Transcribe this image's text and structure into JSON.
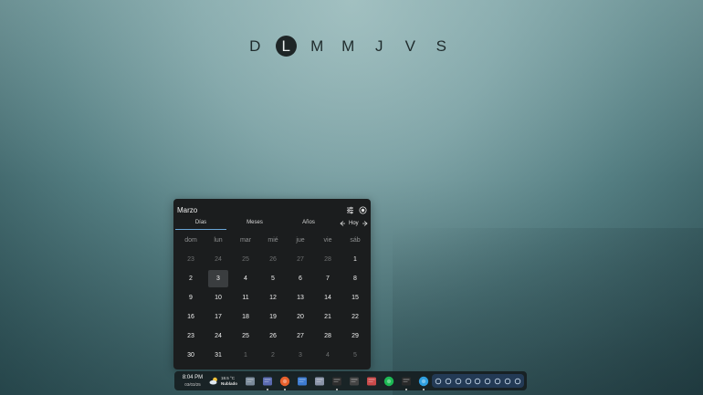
{
  "weekdays": [
    {
      "label": "D",
      "active": false
    },
    {
      "label": "L",
      "active": true
    },
    {
      "label": "M",
      "active": false
    },
    {
      "label": "M",
      "active": false
    },
    {
      "label": "J",
      "active": false
    },
    {
      "label": "V",
      "active": false
    },
    {
      "label": "S",
      "active": false
    }
  ],
  "calendar": {
    "title": "Marzo",
    "tabs": [
      {
        "label": "Días",
        "active": true
      },
      {
        "label": "Meses",
        "active": false
      },
      {
        "label": "Años",
        "active": false
      }
    ],
    "today_label": "Hoy",
    "day_headers": [
      "dom",
      "lun",
      "mar",
      "mié",
      "jue",
      "vie",
      "sáb"
    ],
    "weeks": [
      [
        {
          "d": "23",
          "o": true
        },
        {
          "d": "24",
          "o": true
        },
        {
          "d": "25",
          "o": true
        },
        {
          "d": "26",
          "o": true
        },
        {
          "d": "27",
          "o": true
        },
        {
          "d": "28",
          "o": true
        },
        {
          "d": "1",
          "o": false
        }
      ],
      [
        {
          "d": "2",
          "o": false
        },
        {
          "d": "3",
          "o": false,
          "today": true
        },
        {
          "d": "4",
          "o": false
        },
        {
          "d": "5",
          "o": false
        },
        {
          "d": "6",
          "o": false
        },
        {
          "d": "7",
          "o": false
        },
        {
          "d": "8",
          "o": false
        }
      ],
      [
        {
          "d": "9",
          "o": false
        },
        {
          "d": "10",
          "o": false
        },
        {
          "d": "11",
          "o": false
        },
        {
          "d": "12",
          "o": false
        },
        {
          "d": "13",
          "o": false
        },
        {
          "d": "14",
          "o": false
        },
        {
          "d": "15",
          "o": false
        }
      ],
      [
        {
          "d": "16",
          "o": false
        },
        {
          "d": "17",
          "o": false
        },
        {
          "d": "18",
          "o": false
        },
        {
          "d": "19",
          "o": false
        },
        {
          "d": "20",
          "o": false
        },
        {
          "d": "21",
          "o": false
        },
        {
          "d": "22",
          "o": false
        }
      ],
      [
        {
          "d": "23",
          "o": false
        },
        {
          "d": "24",
          "o": false
        },
        {
          "d": "25",
          "o": false
        },
        {
          "d": "26",
          "o": false
        },
        {
          "d": "27",
          "o": false
        },
        {
          "d": "28",
          "o": false
        },
        {
          "d": "29",
          "o": false
        }
      ],
      [
        {
          "d": "30",
          "o": false
        },
        {
          "d": "31",
          "o": false
        },
        {
          "d": "1",
          "o": true
        },
        {
          "d": "2",
          "o": true
        },
        {
          "d": "3",
          "o": true
        },
        {
          "d": "4",
          "o": true
        },
        {
          "d": "5",
          "o": true
        }
      ]
    ]
  },
  "taskbar": {
    "time": "8:04 PM",
    "date": "03/03/25",
    "temperature": "18.5 °C",
    "weather_text": "Nublado",
    "apps": [
      {
        "name": "app-launcher-icon",
        "color": "#7a8a9a",
        "running": false
      },
      {
        "name": "files-app-icon",
        "color": "#5a6ab0",
        "running": true
      },
      {
        "name": "firefox-icon",
        "color": "#e8602c",
        "running": true
      },
      {
        "name": "file-manager-icon",
        "color": "#3d7bd0",
        "running": false
      },
      {
        "name": "image-viewer-icon",
        "color": "#8a94a8",
        "running": false
      },
      {
        "name": "terminal-icon",
        "color": "#2e2e2e",
        "running": true
      },
      {
        "name": "calculator-icon",
        "color": "#444444",
        "running": false
      },
      {
        "name": "document-viewer-icon",
        "color": "#c94a4a",
        "running": false
      },
      {
        "name": "spotify-icon",
        "color": "#1db954",
        "running": false
      },
      {
        "name": "package-icon",
        "color": "#2a2a2a",
        "running": true
      },
      {
        "name": "web-browser-icon",
        "color": "#2f9fe0",
        "running": true
      }
    ],
    "tray": [
      "notification-icon",
      "media-icon",
      "link-icon",
      "record-icon",
      "brightness-icon",
      "clock-icon",
      "wifi-icon",
      "bluetooth-icon",
      "settings-icon"
    ]
  }
}
